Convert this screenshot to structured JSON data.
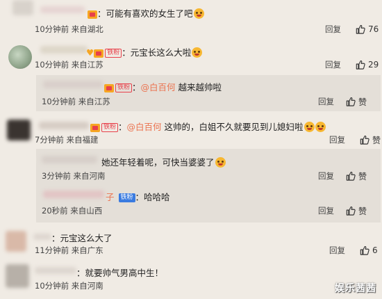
{
  "comments": [
    {
      "text": "：可能有喜欢的女生了吧",
      "time": "10分钟前",
      "location": "来自湖北",
      "reply": "回复",
      "likes": "76"
    },
    {
      "text": "元宝长这么大啦",
      "fan_badge": "铁粉",
      "time": "10分钟前",
      "location": "来自江苏",
      "reply": "回复",
      "likes": "29"
    },
    {
      "mention": "@白百何",
      "text": " 越来越帅啦",
      "fan_badge": "铁粉",
      "time": "10分钟前",
      "location": "来自江苏",
      "reply": "回复",
      "likes": "赞"
    },
    {
      "mention": "@白百何",
      "text": " 这帅的，白姐不久就要见到儿媳妇啦",
      "fan_badge": "铁粉",
      "time": "7分钟前",
      "location": "来自福建",
      "reply": "回复",
      "likes": "赞"
    },
    {
      "text": "她还年轻着呢，可快当婆婆了",
      "time": "3分钟前",
      "location": "来自河南",
      "reply": "回复",
      "likes": "赞"
    },
    {
      "name_suffix": "子",
      "text": "哈哈哈",
      "fan_badge": "铁粉",
      "time": "20秒前",
      "location": "来自山西",
      "reply": "回复",
      "likes": "赞"
    },
    {
      "text": "：元宝这么大了",
      "time": "11分钟前",
      "location": "来自广东",
      "reply": "回复",
      "likes": "6"
    },
    {
      "text": "：就要帅气男高中生！",
      "time": "10分钟前",
      "location": "来自河南",
      "reply": "回复",
      "likes": ""
    }
  ],
  "watermark": "娱乐茜茜",
  "colors": {
    "background": "#f0ebe4",
    "reply_background": "#e4dfd8",
    "mention": "#eb7350"
  }
}
